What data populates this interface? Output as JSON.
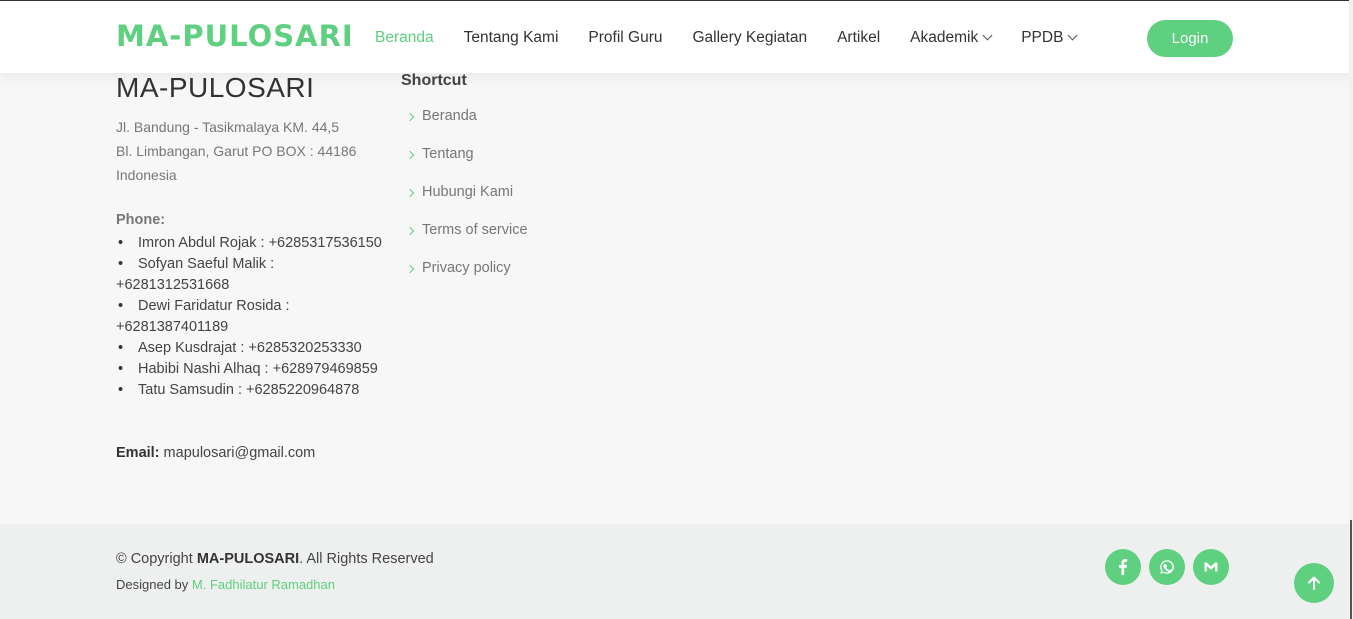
{
  "header": {
    "logo": "MA-PULOSARI",
    "nav": [
      {
        "label": "Beranda",
        "active": true
      },
      {
        "label": "Tentang Kami"
      },
      {
        "label": "Profil Guru"
      },
      {
        "label": "Gallery Kegiatan"
      },
      {
        "label": "Artikel"
      },
      {
        "label": "Akademik",
        "dropdown": true
      },
      {
        "label": "PPDB",
        "dropdown": true
      }
    ],
    "login_label": "Login"
  },
  "footer": {
    "brand": "MA-PULOSARI",
    "address_lines": [
      "Jl. Bandung - Tasikmalaya KM. 44,5",
      "Bl. Limbangan, Garut PO BOX : 44186",
      "Indonesia"
    ],
    "phone_label": "Phone:",
    "phones": [
      "Imron Abdul Rojak : +6285317536150",
      "Sofyan Saeful Malik : +6281312531668",
      "Dewi Faridatur Rosida : +6281387401189",
      "Asep Kusdrajat : +6285320253330",
      "Habibi Nashi Alhaq : +628979469859",
      "Tatu Samsudin : +6285220964878"
    ],
    "email_label": "Email:",
    "email": "mapulosari@gmail.com",
    "shortcut_title": "Shortcut",
    "shortcuts": [
      "Beranda",
      "Tentang",
      "Hubungi Kami",
      "Terms of service",
      "Privacy policy"
    ]
  },
  "bottom": {
    "copyright_prefix": "© Copyright",
    "copyright_brand": "MA-PULOSARI",
    "copyright_suffix": ". All Rights Reserved",
    "designed_prefix": "Designed by",
    "designer": "M. Fadhilatur Ramadhan",
    "social_icons": [
      "facebook-icon",
      "whatsapp-icon",
      "gmail-icon"
    ]
  },
  "colors": {
    "accent": "#5fcf80",
    "background": "#f7f7f7",
    "bottom_bar": "#eef0ef"
  }
}
